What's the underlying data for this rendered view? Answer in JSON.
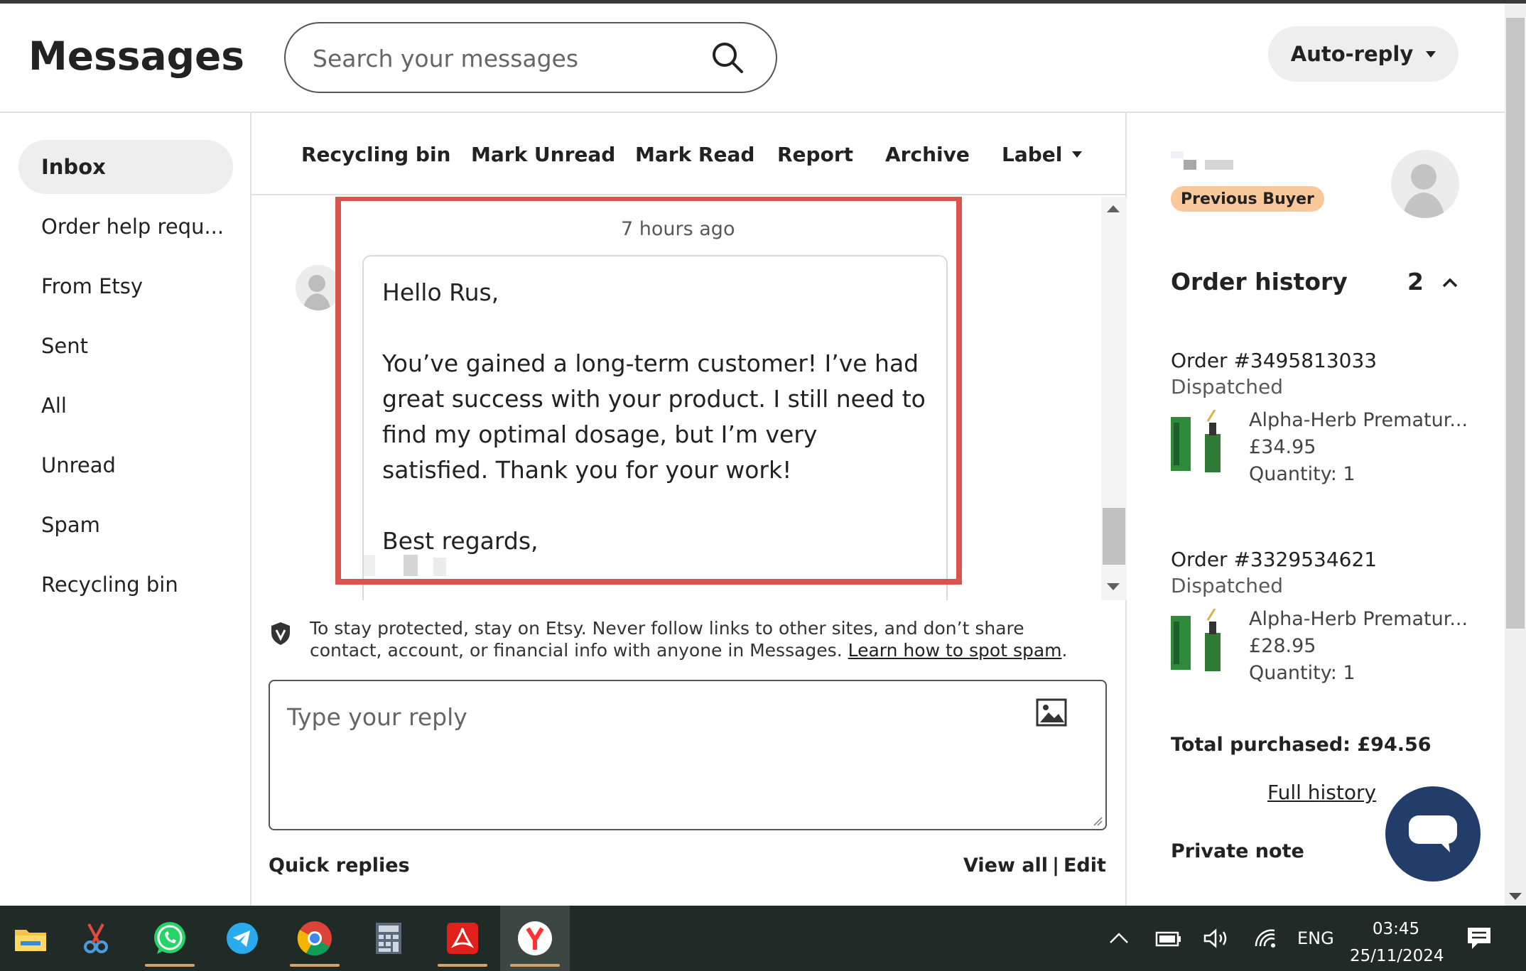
{
  "header": {
    "title": "Messages",
    "search_placeholder": "Search your messages",
    "autoreply_label": "Auto-reply"
  },
  "sidebar": {
    "items": [
      {
        "label": "Inbox",
        "active": true
      },
      {
        "label": "Order help requ..."
      },
      {
        "label": "From Etsy"
      },
      {
        "label": "Sent"
      },
      {
        "label": "All"
      },
      {
        "label": "Unread"
      },
      {
        "label": "Spam"
      },
      {
        "label": "Recycling bin"
      }
    ]
  },
  "toolbar": {
    "recycling_bin": "Recycling bin",
    "mark_unread": "Mark Unread",
    "mark_read": "Mark Read",
    "report": "Report",
    "archive": "Archive",
    "label": "Label"
  },
  "thread": {
    "timestamp": "7 hours ago",
    "greeting": "Hello Rus,",
    "body": "You’ve gained a long-term customer! I’ve had great success with your product. I still need to find my optimal dosage, but I’m very satisfied. Thank you for your work!",
    "closing": "Best regards,"
  },
  "notice": {
    "text": "To stay protected, stay on Etsy. Never follow links to other sites, and don’t share contact, account, or financial info with anyone in Messages.",
    "link": "Learn how to spot spam",
    "period": "."
  },
  "reply": {
    "placeholder": "Type your reply"
  },
  "quick_replies": {
    "label": "Quick replies",
    "view_all": "View all",
    "separator": "|",
    "edit": "Edit"
  },
  "buyer": {
    "badge": "Previous Buyer"
  },
  "order_history": {
    "title": "Order history",
    "count": "2",
    "orders": [
      {
        "id": "Order #3495813033",
        "status": "Dispatched",
        "product": "Alpha-Herb Prematur...",
        "price": "£34.95",
        "quantity": "Quantity: 1"
      },
      {
        "id": "Order #3329534621",
        "status": "Dispatched",
        "product": "Alpha-Herb Prematur...",
        "price": "£28.95",
        "quantity": "Quantity: 1"
      }
    ],
    "total": "Total purchased: £94.56",
    "full_history": "Full history",
    "private_note": "Private note"
  },
  "taskbar": {
    "language": "ENG",
    "time": "03:45",
    "date": "25/11/2024"
  },
  "colors": {
    "highlight": "#d9534f",
    "badge": "#f9c99b",
    "chat_button": "#233d6b"
  }
}
